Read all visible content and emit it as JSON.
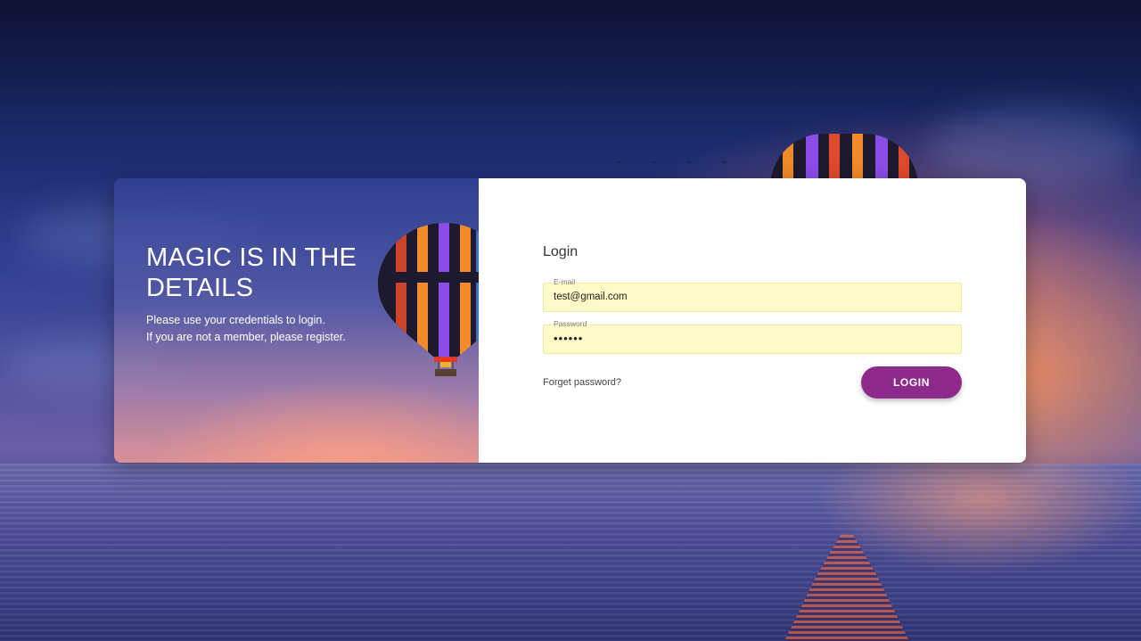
{
  "hero": {
    "title": "MAGIC IS IN THE DETAILS",
    "line1": "Please use your credentials to login.",
    "line2": "If you are not a member, please register."
  },
  "login": {
    "title": "Login",
    "email": {
      "label": "E-mail",
      "value": "test@gmail.com"
    },
    "password": {
      "label": "Password",
      "value": "••••••"
    },
    "forgot_label": "Forget password?",
    "button_label": "LOGIN"
  },
  "colors": {
    "accent": "#8e2a8c",
    "field_bg": "#fffac8"
  },
  "icons": [
    "hot-air-balloon-icon"
  ]
}
